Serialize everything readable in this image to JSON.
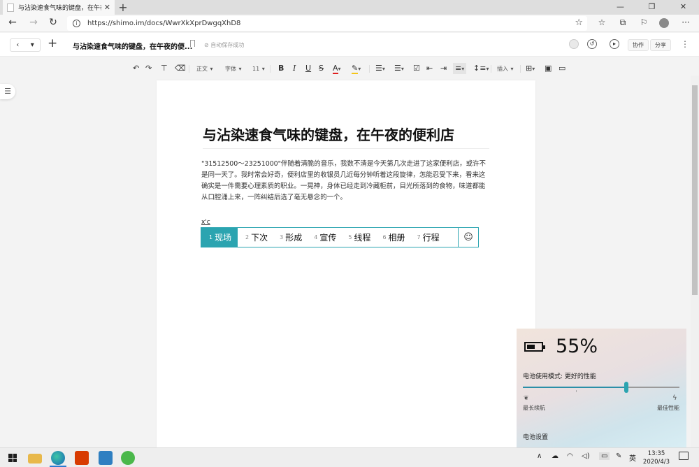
{
  "browser": {
    "tab_title": "与沾染速食气味的键盘，在午夜的便利店",
    "tab_close": "✕",
    "new_tab": "+",
    "url": "https://shimo.im/docs/WwrXkXprDwgqXhD8",
    "win_minimize": "—",
    "win_restore": "❐",
    "win_close": "✕",
    "more": "···"
  },
  "doc_header": {
    "title": "与沾染速食气味的键盘，在午夜的便...",
    "save_status": "⊘ 自动保存成功",
    "collab_label": "协作",
    "share_label": "分享",
    "more": "⋮"
  },
  "toolbar": {
    "style_label": "正文",
    "font_label": "字体",
    "size_label": "11",
    "insert_label": "插入"
  },
  "document": {
    "heading": "与沾染速食气味的键盘，在午夜的便利店",
    "paragraph": "\"31512500～23251000\"伴随着清脆的音乐，我数不清是今天第几次走进了这家便利店，或许不是同一天了。我时常会好奇，便利店里的收银员几近每分钟听着这段旋律，怎能忍受下来，看来这确实是一件需要心理素质的职业。一晃神，身体已经走到冷藏柜前，目光所落到的食物，味道都能从口腔涌上来，一阵纠结后选了毫无悬念的一个。",
    "ime_composition": "x'c"
  },
  "ime": {
    "candidates": [
      {
        "num": "1",
        "text": "现场"
      },
      {
        "num": "2",
        "text": "下次"
      },
      {
        "num": "3",
        "text": "形成"
      },
      {
        "num": "4",
        "text": "宣传"
      },
      {
        "num": "5",
        "text": "线程"
      },
      {
        "num": "6",
        "text": "相册"
      },
      {
        "num": "7",
        "text": "行程"
      }
    ],
    "emoji": "☺",
    "accent_color": "#2ba4b0"
  },
  "battery": {
    "percent_text": "55%",
    "level": 0.55,
    "mode_label": "电池使用模式: 更好的性能",
    "slider_position": 0.66,
    "left_label": "最长续航",
    "right_label": "最佳性能",
    "settings_link": "电池设置"
  },
  "taskbar": {
    "ime_lang": "英",
    "time": "13:35",
    "date": "2020/4/3"
  }
}
